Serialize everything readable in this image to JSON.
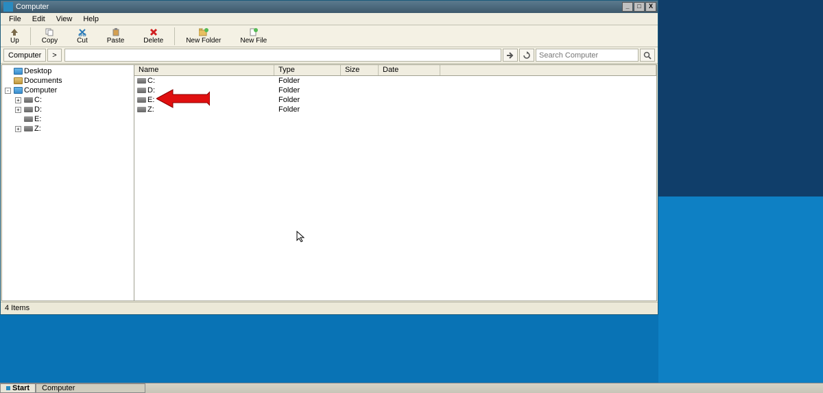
{
  "window": {
    "title": "Computer",
    "menus": {
      "file": "File",
      "edit": "Edit",
      "view": "View",
      "help": "Help"
    },
    "tools": {
      "up": "Up",
      "copy": "Copy",
      "cut": "Cut",
      "paste": "Paste",
      "delete": "Delete",
      "newfolder": "New Folder",
      "newfile": "New File"
    },
    "breadcrumb": "Computer",
    "breadcrumb_arrow": ">",
    "search_placeholder": "Search Computer"
  },
  "tree": {
    "desktop": "Desktop",
    "documents": "Documents",
    "computer": "Computer",
    "drives": {
      "c": "C:",
      "d": "D:",
      "e": "E:",
      "z": "Z:"
    }
  },
  "list": {
    "columns": {
      "name": "Name",
      "type": "Type",
      "size": "Size",
      "date": "Date"
    },
    "rows": [
      {
        "name": "C:",
        "type": "Folder"
      },
      {
        "name": "D:",
        "type": "Folder"
      },
      {
        "name": "E:",
        "type": "Folder"
      },
      {
        "name": "Z:",
        "type": "Folder"
      }
    ]
  },
  "status": "4 Items",
  "taskbar": {
    "start": "Start",
    "task": "Computer"
  }
}
